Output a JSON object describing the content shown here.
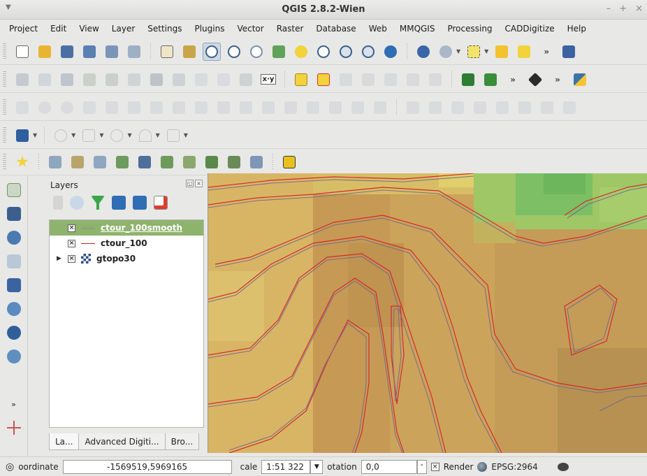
{
  "window": {
    "title": "QGIS 2.8.2-Wien",
    "buttons": [
      "–",
      "+",
      "×"
    ]
  },
  "menubar": [
    "Project",
    "Edit",
    "View",
    "Layer",
    "Settings",
    "Plugins",
    "Vector",
    "Raster",
    "Database",
    "Web",
    "MMQGIS",
    "Processing",
    "CADDigitize",
    "Help"
  ],
  "toolbars": {
    "file_nav": [
      "new-project-icon",
      "open-project-icon",
      "save-project-icon",
      "save-as-icon",
      "new-print-composer-icon",
      "composer-manager-icon",
      "pan-icon",
      "pan-to-selection-icon",
      "zoom-in-icon",
      "zoom-out-icon",
      "zoom-actual-icon",
      "zoom-full-icon",
      "zoom-to-selection-icon",
      "zoom-to-layer-icon",
      "zoom-last-icon",
      "zoom-next-icon",
      "refresh-icon",
      "identify-icon",
      "select-icon",
      "deselect-icon",
      "field-calculator-icon",
      "more-icon",
      "help-icon"
    ],
    "digitize": [
      "edit-pencil-icon",
      "toggle-editing-icon",
      "save-edits-icon",
      "add-feature-icon",
      "move-feature-icon",
      "node-tool-icon",
      "delete-selected-icon",
      "cut-icon",
      "copy-icon",
      "paste-icon",
      "select-by-expression-icon",
      "xy-label-icon",
      "label-abc-icon",
      "label-pin-icon",
      "label-move-icon",
      "label-rotate-icon",
      "label-change-icon",
      "label-show-icon",
      "label-hide-icon",
      "raster-calc-icon",
      "highway-icon",
      "more-icon",
      "processing-icon",
      "more-icon",
      "python-icon"
    ],
    "advanced_digitize": "26 advanced digitizing tools",
    "web": [
      "openlayers-icon",
      "circle-tool-icon",
      "rect-tool-icon",
      "ellipse-tool-icon",
      "arc-tool-icon",
      "polygon-tool-icon"
    ],
    "favorites": [
      "favorites-star-icon",
      "layer-tool-1-icon",
      "layer-tool-2-icon",
      "layer-tool-3-icon",
      "new-vector-icon",
      "new-raster-icon",
      "new-memory-icon",
      "new-virtual-icon",
      "edit-feature-icon",
      "table-icon",
      "export-icon",
      "gps-icon"
    ]
  },
  "xy_label": "x·y",
  "layers_panel": {
    "title": "Layers",
    "layers": [
      {
        "name": "ctour_100smooth",
        "checked": true,
        "selected": true,
        "symbol_color": "#8a8a8a"
      },
      {
        "name": "ctour_100",
        "checked": true,
        "selected": false,
        "symbol_color": "#d32b2b"
      },
      {
        "name": "gtopo30",
        "checked": true,
        "selected": false,
        "expandable": true
      }
    ],
    "tabs": [
      "La...",
      "Advanced Digiti...",
      "Bro..."
    ]
  },
  "statusbar": {
    "coordinate_label": "oordinate",
    "coordinate_value": "-1569519,5969165",
    "scale_label": "cale",
    "scale_value": "1:51 322",
    "rotation_label": "otation",
    "rotation_value": "0,0",
    "render_label": "Render",
    "crs": "EPSG:2964"
  },
  "colors": {
    "selected_layer": "#8eb36c",
    "contour_smooth": "#7c6a8c",
    "contour_raw": "#d32b2b",
    "terrain_low": "#d6ad5f",
    "terrain_high": "#7fc267"
  }
}
